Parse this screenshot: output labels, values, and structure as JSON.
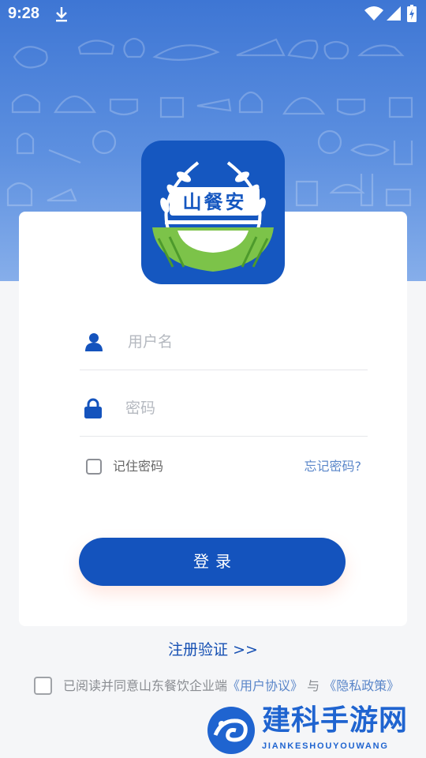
{
  "status_bar": {
    "time": "9:28",
    "icons": [
      "download-icon",
      "wifi-icon",
      "signal-icon",
      "battery-icon"
    ]
  },
  "logo": {
    "text": "山餐安",
    "colors": {
      "background": "#1557c0",
      "wheat": "#7cc349",
      "bowl": "#ffffff"
    }
  },
  "form": {
    "username_placeholder": "用户名",
    "password_placeholder": "密码",
    "username_value": "",
    "password_value": "",
    "remember_label": "记住密码",
    "remember_checked": false,
    "forgot_label": "忘记密码?",
    "login_label": "登录"
  },
  "register_label": "注册验证 >>",
  "agreement": {
    "prefix": "已阅读并同意山东餐饮企业端",
    "user_agreement": "《用户协议》",
    "connector": "与",
    "privacy_policy": "《隐私政策》",
    "checked": false
  },
  "watermark": {
    "title": "建科手游网",
    "subtitle": "JIANKESHOUYOUWANG"
  },
  "colors": {
    "primary": "#1453bd",
    "link": "#5a86c9",
    "hero_top": "#3e76d4",
    "hero_bottom": "#86aeea"
  }
}
